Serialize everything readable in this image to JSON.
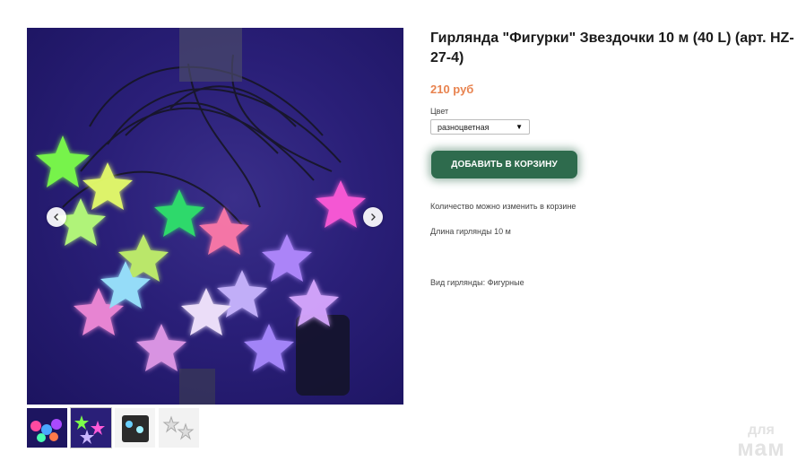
{
  "product": {
    "title": "Гирлянда \"Фигурки\" Звездочки 10 м (40 L) (арт. HZ-27-4)",
    "price": "210 руб",
    "color_label": "Цвет",
    "color_value": "разноцветная",
    "add_to_cart": "ДОБАВИТЬ В КОРЗИНУ",
    "qty_note": "Количество можно изменить в корзине",
    "length_note": "Длина гирлянды 10 м",
    "type_note": "Вид гирлянды: Фигурные"
  },
  "gallery": {
    "thumbnails": [
      "thumb-1",
      "thumb-2",
      "thumb-3",
      "thumb-4"
    ],
    "active_index": 1
  },
  "watermark": {
    "line1": "для",
    "line2": "мам"
  },
  "colors": {
    "accent_button": "#2e6b4d",
    "price": "#e8834f",
    "photo_bg": "#2a1f78"
  },
  "icons": [
    "chevron-left-icon",
    "chevron-right-icon",
    "dropdown-caret-icon"
  ]
}
